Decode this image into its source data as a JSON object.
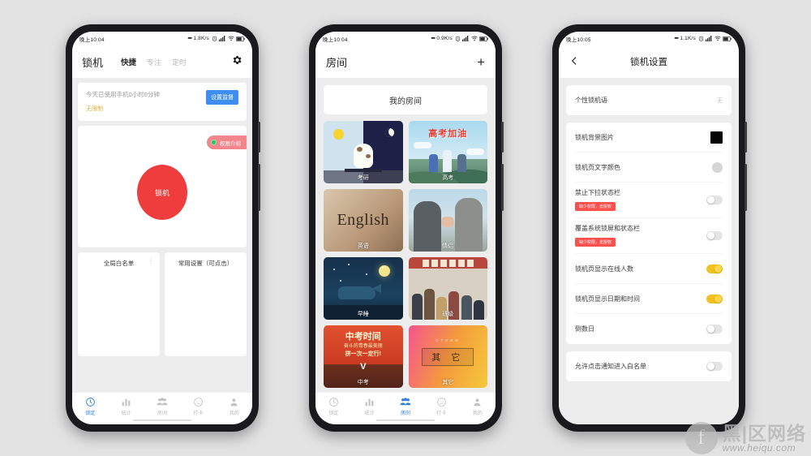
{
  "statusbars": {
    "phone1": {
      "time": "晚上10:04",
      "net": "1.8K/s",
      "icons": [
        "alarm-icon",
        "signal-icon",
        "wifi-icon",
        "battery-icon"
      ]
    },
    "phone2": {
      "time": "晚上10:04",
      "net": "0.9K/s",
      "icons": [
        "alarm-icon",
        "signal-icon",
        "wifi-icon",
        "battery-icon"
      ]
    },
    "phone3": {
      "time": "晚上10:05",
      "net": "1.1K/s",
      "icons": [
        "alarm-icon",
        "signal-icon",
        "wifi-icon",
        "battery-icon"
      ]
    }
  },
  "phone1": {
    "header": {
      "title": "锁机",
      "tabs": [
        {
          "label": "快捷",
          "active": true
        },
        {
          "label": "专注",
          "active": false
        },
        {
          "label": "定时",
          "active": false
        }
      ],
      "settings_icon": "gear-icon"
    },
    "usage_card": {
      "main_text": "今天已使用手机0小时0分钟",
      "sub_text": "无限制",
      "button_label": "设置监督"
    },
    "lock_card": {
      "permission_pill": "权限介绍",
      "lock_button": "锁机"
    },
    "mini_cards": [
      {
        "title": "全局白名单",
        "has_menu": true
      },
      {
        "title": "常用设置（可点击）",
        "has_menu": false
      }
    ],
    "bottom_nav": [
      {
        "label": "锁定",
        "icon": "clock-icon",
        "active": true
      },
      {
        "label": "统计",
        "icon": "bar-chart-icon",
        "active": false
      },
      {
        "label": "房间",
        "icon": "people-icon",
        "active": false
      },
      {
        "label": "打卡",
        "icon": "smiley-icon",
        "active": false
      },
      {
        "label": "我的",
        "icon": "person-icon",
        "active": false
      }
    ]
  },
  "phone2": {
    "header": {
      "title": "房间",
      "add_icon": "plus-icon"
    },
    "my_room_label": "我的房间",
    "rooms": [
      {
        "label": "考研",
        "art": "kaoyan"
      },
      {
        "label": "高考",
        "art": "gaokao",
        "art_text": "高考加油"
      },
      {
        "label": "英语",
        "art": "english",
        "art_text": "English"
      },
      {
        "label": "情侣",
        "art": "couple"
      },
      {
        "label": "早睡",
        "art": "sleep"
      },
      {
        "label": "班级",
        "art": "class"
      },
      {
        "label": "中考",
        "art": "zhongkao",
        "art_text": "中考时间",
        "art_text2": "奋斗的青春最美丽",
        "art_text3": "拼一次一定行!"
      },
      {
        "label": "其它",
        "art": "other",
        "art_text": "其 它"
      }
    ],
    "bottom_nav": [
      {
        "label": "锁定",
        "icon": "clock-icon",
        "active": false
      },
      {
        "label": "统计",
        "icon": "bar-chart-icon",
        "active": false
      },
      {
        "label": "房间",
        "icon": "people-icon",
        "active": true
      },
      {
        "label": "打卡",
        "icon": "smiley-icon",
        "active": false
      },
      {
        "label": "我的",
        "icon": "person-icon",
        "active": false
      }
    ]
  },
  "phone3": {
    "header": {
      "back_icon": "back-arrow-icon",
      "title": "锁机设置"
    },
    "group1": [
      {
        "label": "个性锁机语",
        "control": "value",
        "value": "无"
      }
    ],
    "group2": [
      {
        "label": "锁机背景图片",
        "control": "swatch",
        "color": "#050505"
      },
      {
        "label": "锁机页文字颜色",
        "control": "circle",
        "color": "#d6d6d6"
      },
      {
        "label": "禁止下拉状态栏",
        "control": "toggle",
        "on": false,
        "badge": "缺少权限，去授权"
      },
      {
        "label": "覆盖系统锁屏和状态栏",
        "control": "toggle",
        "on": false,
        "badge": "缺少权限，去授权"
      },
      {
        "label": "锁机页显示在线人数",
        "control": "toggle",
        "on": true
      },
      {
        "label": "锁机页显示日期和时间",
        "control": "toggle",
        "on": true
      },
      {
        "label": "倒数日",
        "control": "toggle",
        "on": false
      }
    ],
    "group3": [
      {
        "label": "允许点击通知进入白名单",
        "control": "toggle",
        "on": false
      }
    ]
  },
  "watermark": {
    "cn": "黑|区网络",
    "en": "www.heiqu.com",
    "logo": "f-logo"
  },
  "colors": {
    "accent_blue": "#2f7de1",
    "lock_red": "#ef3c3c",
    "pill_pink": "#f2868c",
    "toggle_on": "#f3c11f",
    "badge_red": "#f8514e",
    "page_bg": "#e3e3e3"
  }
}
